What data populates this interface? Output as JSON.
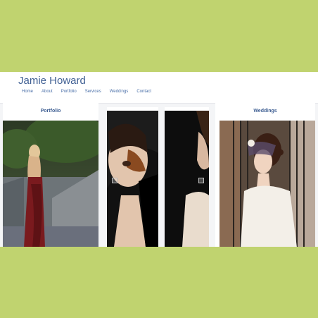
{
  "site": {
    "brand": "Jamie Howard",
    "nav": [
      "Home",
      "About",
      "Portfolio",
      "Services",
      "Weddings",
      "Contact"
    ]
  },
  "cards": {
    "portfolio_title": "Portfolio",
    "weddings_title": "Weddings"
  },
  "colors": {
    "background": "#c0d36f",
    "brand": "#3f5f93",
    "nav_link": "#4a6fa8"
  }
}
